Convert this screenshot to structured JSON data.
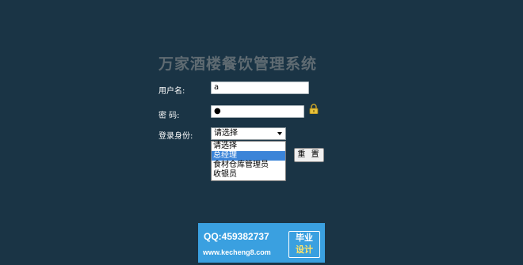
{
  "title": "万家酒楼餐饮管理系统",
  "form": {
    "username_label": "用户名:",
    "username_value": "a",
    "password_label": "密  码:",
    "password_value": "●",
    "role_label": "登录身份:",
    "role_selected": "请选择",
    "role_options": [
      "请选择",
      "总经理",
      "食材仓库管理员",
      "收银员"
    ],
    "reset_label": "重 置"
  },
  "banner": {
    "qq": "QQ:459382737",
    "site": "www.kecheng8.com",
    "badge_line1": "毕业",
    "badge_line2": "设计"
  }
}
